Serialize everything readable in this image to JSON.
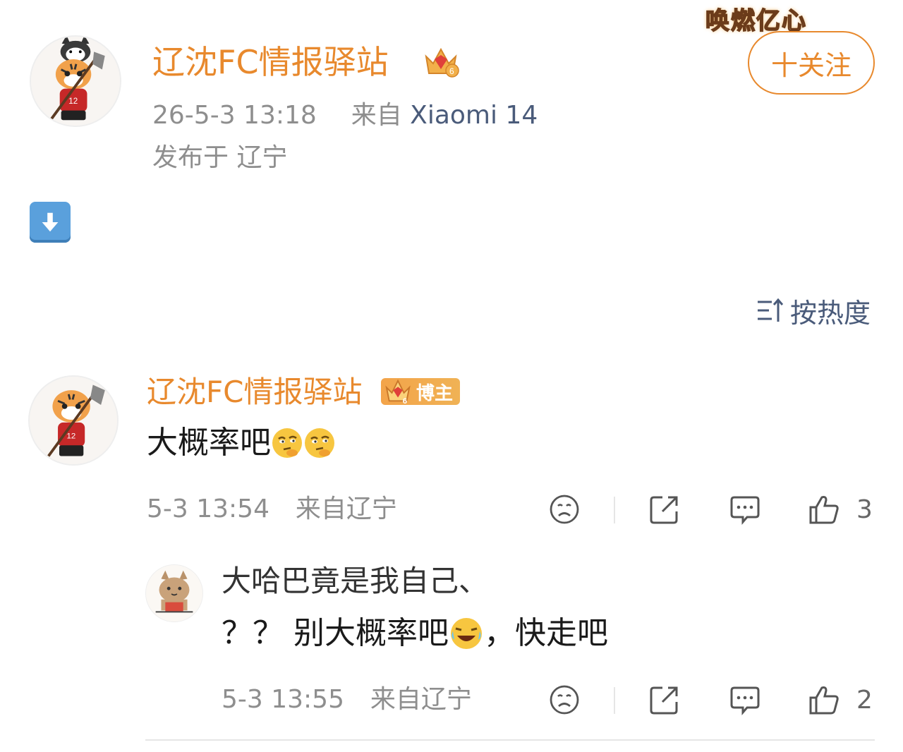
{
  "watermark": "唤燃亿心",
  "post": {
    "author": "辽沈FC情报驿站",
    "time": "26-5-3 13:18",
    "source_prefix": "来自",
    "device": "Xiaomi 14",
    "location": "发布于 辽宁",
    "follow_label": "十关注",
    "content_emoji": "⬇️"
  },
  "sort": {
    "icon": "sort-icon",
    "label": "按热度"
  },
  "comments": [
    {
      "author": "辽沈FC情报驿站",
      "badge": "博主",
      "text": "大概率吧",
      "emojis": [
        "thinking-face-icon",
        "thinking-face-icon"
      ],
      "time": "5-3 13:54",
      "from": "来自辽宁",
      "likes": "3"
    }
  ],
  "reply": {
    "author": "大哈巴竟是我自己、",
    "text_before": "？？ 别大概率吧",
    "text_after": "，快走吧",
    "emoji": "laughing-crying-icon",
    "time": "5-3 13:55",
    "from": "来自辽宁",
    "likes": "2"
  },
  "colors": {
    "accent": "#e8892d",
    "gray_text": "#8e8e8e",
    "device_blue": "#4a5b7a"
  }
}
